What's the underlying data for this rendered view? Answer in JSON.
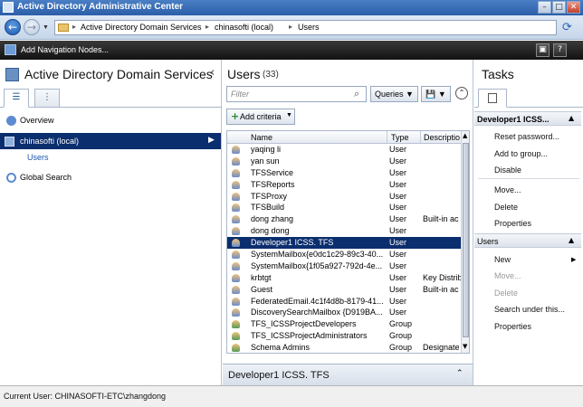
{
  "window": {
    "title": "Active Directory Administrative Center",
    "minimize_glyph": "–",
    "maximize_glyph": "□",
    "close_glyph": "✕"
  },
  "address": {
    "crumbs": [
      "Active Directory Domain Services",
      "chinasofti (local)",
      "Users"
    ],
    "separator": "▸",
    "back_glyph": "←",
    "forward_glyph": "→",
    "dropdown_glyph": "▼",
    "refresh_glyph": "⟳"
  },
  "nav_bar": {
    "add_nodes_label": "Add Navigation Nodes...",
    "help_glyph": "?",
    "manage_glyph": "▣"
  },
  "left_pane": {
    "title": "Active Directory Domain Services",
    "collapse_glyph": "‹",
    "tab_list_glyph": "☰",
    "tab_tree_glyph": "⋮",
    "items": [
      {
        "label": "Overview"
      },
      {
        "label": "chinasofti (local)"
      },
      {
        "label": "Users"
      },
      {
        "label": "Global Search"
      }
    ],
    "selected_arrow": "▶"
  },
  "middle_pane": {
    "title": "Users",
    "count": "(33)",
    "filter_placeholder": "Filter",
    "search_glyph": "⌕",
    "queries_label": "Queries ▼",
    "save_label": "💾 ▼",
    "collapse_glyph": "⌃",
    "add_criteria_label": "Add criteria",
    "add_criteria_plus": "+",
    "add_criteria_dropdown": "▼",
    "columns": [
      "Name",
      "Type",
      "Descriptio"
    ],
    "rows": [
      {
        "name": "yaqing li",
        "type": "User",
        "desc": "",
        "kind": "user"
      },
      {
        "name": "yan sun",
        "type": "User",
        "desc": "",
        "kind": "user"
      },
      {
        "name": "TFSService",
        "type": "User",
        "desc": "",
        "kind": "user"
      },
      {
        "name": "TFSReports",
        "type": "User",
        "desc": "",
        "kind": "user"
      },
      {
        "name": "TFSProxy",
        "type": "User",
        "desc": "",
        "kind": "user"
      },
      {
        "name": "TFSBuild",
        "type": "User",
        "desc": "",
        "kind": "user"
      },
      {
        "name": "dong zhang",
        "type": "User",
        "desc": "Built-in ac",
        "kind": "user"
      },
      {
        "name": "dong dong",
        "type": "User",
        "desc": "",
        "kind": "user"
      },
      {
        "name": "Developer1 ICSS. TFS",
        "type": "User",
        "desc": "",
        "kind": "user",
        "selected": true
      },
      {
        "name": "SystemMailbox{e0dc1c29-89c3-40...",
        "type": "User",
        "desc": "",
        "kind": "user"
      },
      {
        "name": "SystemMailbox{1f05a927-792d-4e...",
        "type": "User",
        "desc": "",
        "kind": "user"
      },
      {
        "name": "krbtgt",
        "type": "User",
        "desc": "Key Distrib",
        "kind": "user"
      },
      {
        "name": "Guest",
        "type": "User",
        "desc": "Built-in ac",
        "kind": "user"
      },
      {
        "name": "FederatedEmail.4c1f4d8b-8179-41...",
        "type": "User",
        "desc": "",
        "kind": "user"
      },
      {
        "name": "DiscoverySearchMailbox {D919BA...",
        "type": "User",
        "desc": "",
        "kind": "user"
      },
      {
        "name": "TFS_ICSSProjectDevelopers",
        "type": "Group",
        "desc": "",
        "kind": "group"
      },
      {
        "name": "TFS_ICSSProjectAdministrators",
        "type": "Group",
        "desc": "",
        "kind": "group"
      },
      {
        "name": "Schema Admins",
        "type": "Group",
        "desc": "Designate",
        "kind": "group"
      }
    ],
    "scroll_up": "▲",
    "scroll_down": "▼",
    "preview_name": "Developer1 ICSS. TFS",
    "preview_glyph": "⌃"
  },
  "tasks_pane": {
    "title": "Tasks",
    "section1_label": "Developer1 ICSS...",
    "section1_caret": "▲",
    "section1_items": [
      "Reset password...",
      "Add to group...",
      "Disable",
      "Move...",
      "Delete",
      "Properties"
    ],
    "section2_label": "Users",
    "section2_caret": "▲",
    "section2_items": [
      {
        "label": "New",
        "disabled": false,
        "submenu": "▶"
      },
      {
        "label": "Move...",
        "disabled": true
      },
      {
        "label": "Delete",
        "disabled": true
      },
      {
        "label": "Search under this...",
        "disabled": false
      },
      {
        "label": "Properties",
        "disabled": false
      }
    ]
  },
  "status_bar": {
    "text": "Current User: CHINASOFTI-ETC\\zhangdong"
  }
}
